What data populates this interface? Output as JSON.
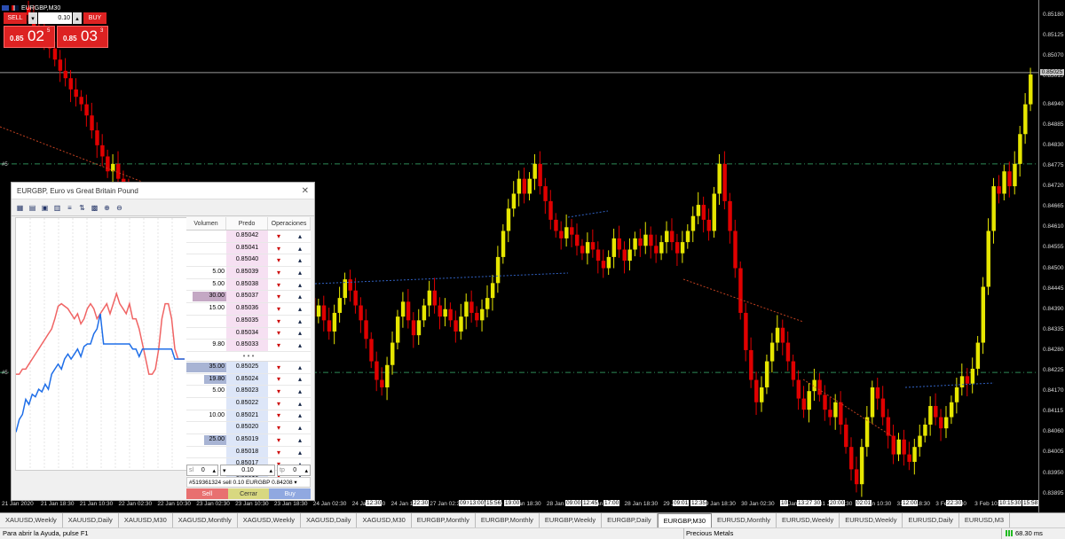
{
  "window": {
    "title": "EURGBP,M30"
  },
  "trade_panel": {
    "sell_label": "SELL",
    "buy_label": "BUY",
    "lot": "0.10",
    "sell_small": "0.85",
    "sell_big": "02",
    "sell_sup": "5",
    "buy_small": "0.85",
    "buy_big": "03",
    "buy_sup": "3"
  },
  "price_axis": {
    "ticks": [
      "0.85180",
      "0.85125",
      "0.85070",
      "0.85015",
      "0.84940",
      "0.84885",
      "0.84830",
      "0.84775",
      "0.84720",
      "0.84665",
      "0.84610",
      "0.84555",
      "0.84500",
      "0.84445",
      "0.84390",
      "0.84335",
      "0.84280",
      "0.84225",
      "0.84170",
      "0.84115",
      "0.84060",
      "0.84005",
      "0.83950",
      "0.83895"
    ],
    "current_tag": "0.85025",
    "ymin": 0.8388,
    "ymax": 0.8522
  },
  "chart_data": {
    "type": "candlestick",
    "symbol": "EURGBP",
    "timeframe": "M30",
    "bid_line": 0.85025,
    "level_upper": 0.8478,
    "level_lower": 0.8422,
    "levels_y_label": "#5",
    "time_labels": [
      "21 Jan 2020",
      "21 Jan 18:30",
      "21 Jan 10:30",
      "22 Jan 02:30",
      "22 Jan 10:30",
      "23 Jan 02:30",
      "23 Jan 10:30",
      "23 Jan 18:30",
      "24 Jan 02:30",
      "24 Jan 10:30",
      "24 Jan 18:30",
      "27 Jan 02:30",
      "27 Jan 10:30",
      "27 Jan 18:30",
      "28 Jan 02:30",
      "28 Jan 10:30",
      "28 Jan 18:30",
      "29 Jan 10:30",
      "29 Jan 18:30",
      "30 Jan 02:30",
      "30 Jan 10:30",
      "31 Jan 02:30",
      "31 Jan 10:30",
      "31 Jan 18:30",
      "3 Feb 02:30",
      "3 Feb 10:30"
    ],
    "time_marks": [
      "12:30",
      "22:30",
      "09:01",
      "13:00",
      "15:56",
      "19:00",
      "09:00",
      "12:45",
      "17:00",
      "09:01",
      "12:35",
      "10",
      "13:27",
      "30",
      "20:00",
      "02:01",
      "12:00",
      "22:30",
      "10:15",
      "30",
      "15:58"
    ],
    "closes": [
      0.8518,
      0.8515,
      0.8514,
      0.8512,
      0.8509,
      0.8506,
      0.8503,
      0.8501,
      0.8498,
      0.8496,
      0.8494,
      0.8491,
      0.8487,
      0.8483,
      0.848,
      0.8476,
      0.8478,
      0.8474,
      0.8471,
      0.8467,
      0.847,
      0.8466,
      0.8462,
      0.8465,
      0.846,
      0.8458,
      0.8455,
      0.8452,
      0.8448,
      0.8446,
      0.8443,
      0.844,
      0.8438,
      0.8435,
      0.8431,
      0.8428,
      0.8425,
      0.8422,
      0.8424,
      0.842,
      0.8418,
      0.8421,
      0.8427,
      0.8423,
      0.843,
      0.8436,
      0.8441,
      0.8438,
      0.8444,
      0.8448,
      0.8446,
      0.845,
      0.8447,
      0.8442,
      0.8437,
      0.844,
      0.8436,
      0.8433,
      0.8438,
      0.8442,
      0.8447,
      0.8444,
      0.844,
      0.8436,
      0.8431,
      0.8425,
      0.842,
      0.8418,
      0.8424,
      0.843,
      0.8437,
      0.8441,
      0.8436,
      0.8432,
      0.8436,
      0.844,
      0.8444,
      0.844,
      0.8437,
      0.8439,
      0.8436,
      0.8433,
      0.8437,
      0.8441,
      0.8438,
      0.8436,
      0.8439,
      0.8442,
      0.8446,
      0.8453,
      0.846,
      0.8466,
      0.847,
      0.8474,
      0.847,
      0.8474,
      0.8478,
      0.8472,
      0.8468,
      0.8463,
      0.846,
      0.8458,
      0.8461,
      0.8459,
      0.8456,
      0.8454,
      0.8457,
      0.8455,
      0.8452,
      0.845,
      0.8453,
      0.8458,
      0.8455,
      0.8452,
      0.8455,
      0.8458,
      0.8456,
      0.8459,
      0.8456,
      0.8454,
      0.8457,
      0.846,
      0.8457,
      0.8454,
      0.8457,
      0.846,
      0.8464,
      0.8467,
      0.8463,
      0.846,
      0.847,
      0.8478,
      0.8468,
      0.846,
      0.845,
      0.8438,
      0.8428,
      0.842,
      0.8414,
      0.8418,
      0.8425,
      0.843,
      0.8434,
      0.843,
      0.8425,
      0.842,
      0.8415,
      0.8412,
      0.8417,
      0.842,
      0.8416,
      0.8412,
      0.841,
      0.8414,
      0.8408,
      0.8402,
      0.8396,
      0.8392,
      0.8402,
      0.841,
      0.8418,
      0.8415,
      0.841,
      0.8405,
      0.84,
      0.8404,
      0.84,
      0.8398,
      0.8402,
      0.8405,
      0.8408,
      0.8413,
      0.841,
      0.8407,
      0.841,
      0.8414,
      0.8418,
      0.8421,
      0.8419,
      0.8423,
      0.843,
      0.8445,
      0.846,
      0.8472,
      0.847,
      0.8476,
      0.8472,
      0.8478,
      0.8486,
      0.8494,
      0.8502
    ]
  },
  "dom": {
    "title": "EURGBP, Euro vs Great Britain Pound",
    "headers": {
      "volume": "Volumen",
      "price": "Predo",
      "operations": "Operaciones"
    },
    "asks": [
      {
        "vol": "",
        "price": "0.85042",
        "bar": 0
      },
      {
        "vol": "",
        "price": "0.85041",
        "bar": 0
      },
      {
        "vol": "",
        "price": "0.85040",
        "bar": 0
      },
      {
        "vol": "5.00",
        "price": "0.85039",
        "bar": 0
      },
      {
        "vol": "5.00",
        "price": "0.85038",
        "bar": 0
      },
      {
        "vol": "30.00",
        "price": "0.85037",
        "bar": 0.85
      },
      {
        "vol": "15.00",
        "price": "0.85036",
        "bar": 0
      },
      {
        "vol": "",
        "price": "0.85035",
        "bar": 0
      },
      {
        "vol": "",
        "price": "0.85034",
        "bar": 0
      },
      {
        "vol": "9.80",
        "price": "0.85033",
        "bar": 0
      }
    ],
    "separator": "• • •",
    "bids": [
      {
        "vol": "35.00",
        "price": "0.85025",
        "bar": 1.0
      },
      {
        "vol": "19.80",
        "price": "0.85024",
        "bar": 0.55
      },
      {
        "vol": "5.00",
        "price": "0.85023",
        "bar": 0
      },
      {
        "vol": "",
        "price": "0.85022",
        "bar": 0
      },
      {
        "vol": "10.00",
        "price": "0.85021",
        "bar": 0
      },
      {
        "vol": "",
        "price": "0.85020",
        "bar": 0
      },
      {
        "vol": "25.00",
        "price": "0.85019",
        "bar": 0.55
      },
      {
        "vol": "",
        "price": "0.85018",
        "bar": 0
      },
      {
        "vol": "",
        "price": "0.85017",
        "bar": 0
      },
      {
        "vol": "",
        "price": "0.85016",
        "bar": 0
      }
    ],
    "sl_label": "sl",
    "sl_value": "0",
    "lot_value": "0.10",
    "tp_label": "tp",
    "tp_value": "0",
    "position": "#519361324 sell 0.10 EURGBP 0.84208",
    "sell_label": "Sell",
    "close_label": "Cerrar",
    "buy_label": "Buy",
    "mini_ask": [
      0.62,
      0.62,
      0.6,
      0.6,
      0.58,
      0.56,
      0.54,
      0.52,
      0.5,
      0.48,
      0.46,
      0.44,
      0.4,
      0.35,
      0.34,
      0.35,
      0.36,
      0.38,
      0.4,
      0.38,
      0.42,
      0.4,
      0.36,
      0.34,
      0.36,
      0.4,
      0.38,
      0.36,
      0.34,
      0.38,
      0.34,
      0.3,
      0.34,
      0.36,
      0.38,
      0.34,
      0.4,
      0.4,
      0.44,
      0.5,
      0.56,
      0.62,
      0.62,
      0.6,
      0.52,
      0.4,
      0.34,
      0.34,
      0.4,
      0.52,
      0.56,
      0.56,
      0.56
    ],
    "mini_bid": [
      0.85,
      0.8,
      0.78,
      0.72,
      0.74,
      0.7,
      0.71,
      0.68,
      0.69,
      0.66,
      0.68,
      0.62,
      0.6,
      0.58,
      0.6,
      0.56,
      0.54,
      0.56,
      0.54,
      0.52,
      0.55,
      0.51,
      0.5,
      0.5,
      0.46,
      0.44,
      0.38,
      0.5,
      0.5,
      0.5,
      0.5,
      0.5,
      0.5,
      0.5,
      0.5,
      0.5,
      0.52,
      0.52,
      0.55,
      0.52,
      0.52,
      0.52,
      0.52,
      0.52,
      0.52,
      0.52,
      0.52,
      0.52,
      0.52,
      0.56,
      0.56,
      0.56,
      0.56
    ]
  },
  "tabs": [
    "XAUUSD,Weekly",
    "XAUUSD,Daily",
    "XAUUSD,M30",
    "XAGUSD,Monthly",
    "XAGUSD,Weekly",
    "XAGUSD,Daily",
    "XAGUSD,M30",
    "EURGBP,Monthly",
    "EURGBP,Monthly",
    "EURGBP,Weekly",
    "EURGBP,Daily",
    "EURGBP,M30",
    "EURUSD,Monthly",
    "EURUSD,Weekly",
    "EURUSD,Weekly",
    "EURUSD,Daily",
    "EURUSD,M3"
  ],
  "active_tab_index": 11,
  "status": {
    "help": "Para abrir la Ayuda, pulse F1",
    "profile": "Precious Metals",
    "ping": "68.30 ms"
  },
  "colors": {
    "bull": "#e6e600",
    "bear": "#e00000",
    "ask_line": "#f06464",
    "bid_line": "#1e6ee8",
    "level": "#2e8b57"
  }
}
